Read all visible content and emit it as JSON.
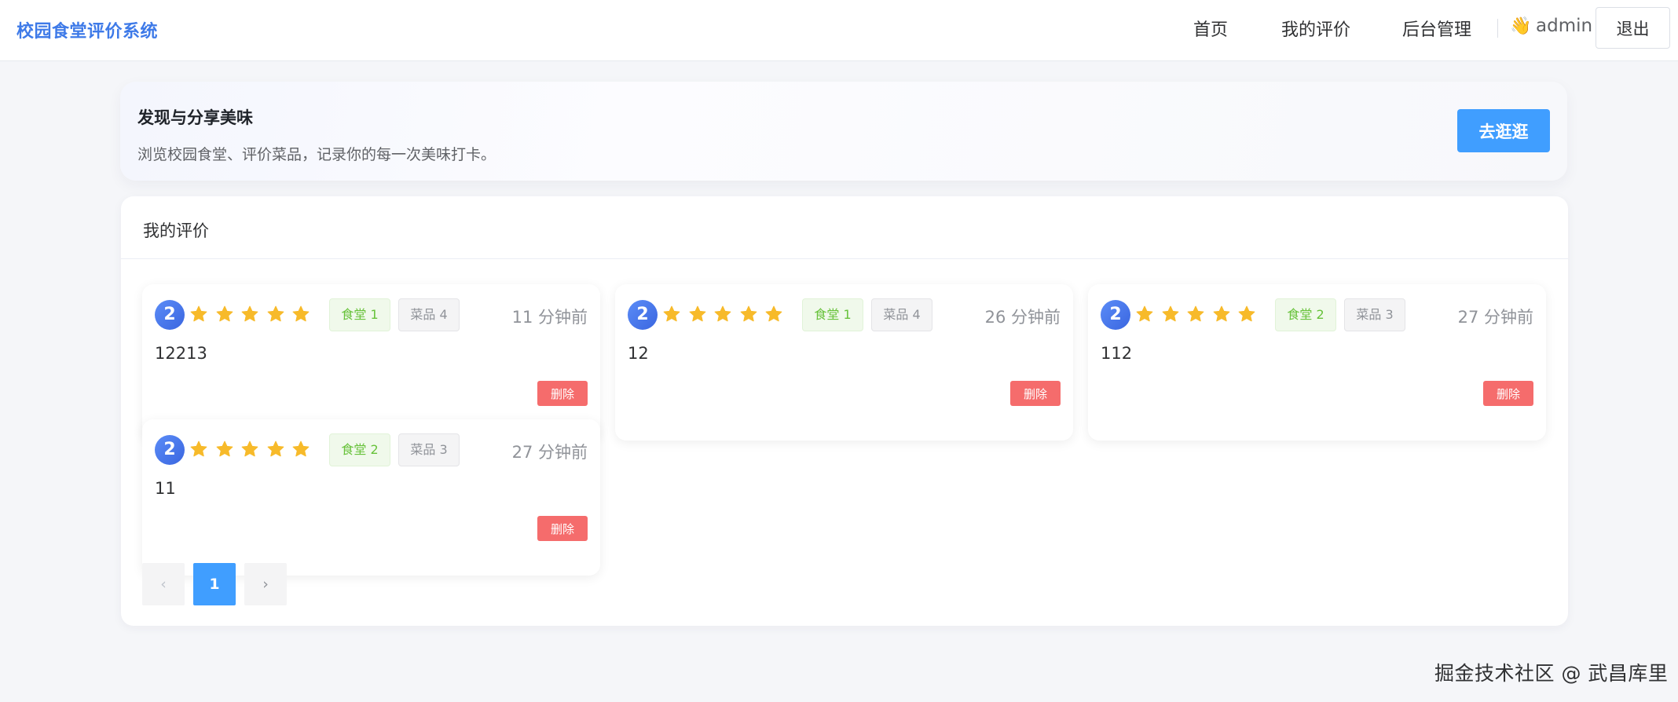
{
  "header": {
    "brand": "校园食堂评价系统",
    "nav": {
      "home": "首页",
      "my_reviews": "我的评价",
      "admin": "后台管理"
    },
    "user": {
      "wave": "👋",
      "name": "admin"
    },
    "logout_label": "退出"
  },
  "hero": {
    "title": "发现与分享美味",
    "subtitle": "浏览校园食堂、评价菜品，记录你的每一次美味打卡。",
    "button_label": "去逛逛"
  },
  "main": {
    "title": "我的评价",
    "reviews": [
      {
        "avatar": "2",
        "rating": 5,
        "canteen": "食堂 1",
        "dish": "菜品 4",
        "time": "11 分钟前",
        "content": "12213",
        "delete_label": "删除"
      },
      {
        "avatar": "2",
        "rating": 5,
        "canteen": "食堂 1",
        "dish": "菜品 4",
        "time": "26 分钟前",
        "content": "12",
        "delete_label": "删除"
      },
      {
        "avatar": "2",
        "rating": 5,
        "canteen": "食堂 2",
        "dish": "菜品 3",
        "time": "27 分钟前",
        "content": "112",
        "delete_label": "删除"
      },
      {
        "avatar": "2",
        "rating": 5,
        "canteen": "食堂 2",
        "dish": "菜品 3",
        "time": "27 分钟前",
        "content": "11",
        "delete_label": "删除"
      }
    ],
    "pagination": {
      "prev": "‹",
      "current": "1",
      "next": "›"
    }
  },
  "watermark": "掘金技术社区 @ 武昌库里",
  "colors": {
    "brand": "#3e7ae8",
    "primary": "#409eff",
    "danger": "#f56c6c",
    "star": "#f7ba2a",
    "success_tag_text": "#67c23a",
    "info_tag_text": "#909399"
  },
  "icons": {
    "star": "star-icon",
    "wave": "waving-hand-icon",
    "prev": "chevron-left-icon",
    "next": "chevron-right-icon"
  }
}
